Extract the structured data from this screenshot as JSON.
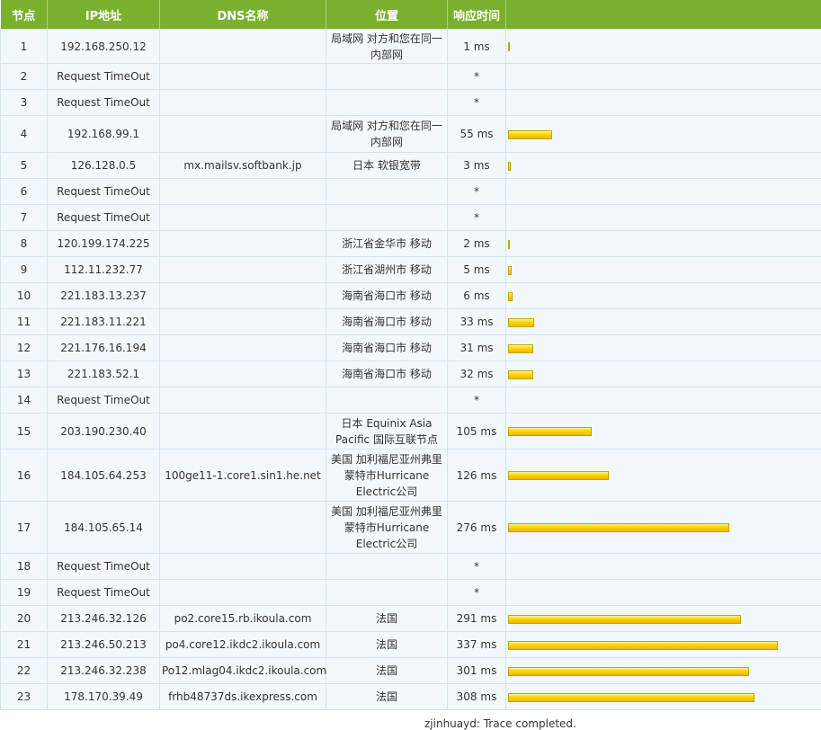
{
  "headers": {
    "hop": "节点",
    "ip": "IP地址",
    "dns": "DNS名称",
    "location": "位置",
    "time": "响应时间",
    "bar": ""
  },
  "rows": [
    {
      "hop": "1",
      "ip": "192.168.250.12",
      "dns": "",
      "location": "局域网 对方和您在同一内部网",
      "time": "1 ms",
      "ms": 1,
      "h": 38
    },
    {
      "hop": "2",
      "ip": "Request TimeOut",
      "dns": "",
      "location": "",
      "time": "*",
      "ms": 0,
      "h": 29
    },
    {
      "hop": "3",
      "ip": "Request TimeOut",
      "dns": "",
      "location": "",
      "time": "*",
      "ms": 0,
      "h": 29
    },
    {
      "hop": "4",
      "ip": "192.168.99.1",
      "dns": "",
      "location": "局域网 对方和您在同一内部网",
      "time": "55 ms",
      "ms": 55,
      "h": 41
    },
    {
      "hop": "5",
      "ip": "126.128.0.5",
      "dns": "mx.mailsv.softbank.jp",
      "location": "日本 软银宽带",
      "time": "3 ms",
      "ms": 3,
      "h": 29
    },
    {
      "hop": "6",
      "ip": "Request TimeOut",
      "dns": "",
      "location": "",
      "time": "*",
      "ms": 0,
      "h": 29
    },
    {
      "hop": "7",
      "ip": "Request TimeOut",
      "dns": "",
      "location": "",
      "time": "*",
      "ms": 0,
      "h": 29
    },
    {
      "hop": "8",
      "ip": "120.199.174.225",
      "dns": "",
      "location": "浙江省金华市 移动",
      "time": "2 ms",
      "ms": 2,
      "h": 29
    },
    {
      "hop": "9",
      "ip": "112.11.232.77",
      "dns": "",
      "location": "浙江省湖州市 移动",
      "time": "5 ms",
      "ms": 5,
      "h": 29
    },
    {
      "hop": "10",
      "ip": "221.183.13.237",
      "dns": "",
      "location": "海南省海口市 移动",
      "time": "6 ms",
      "ms": 6,
      "h": 29
    },
    {
      "hop": "11",
      "ip": "221.183.11.221",
      "dns": "",
      "location": "海南省海口市 移动",
      "time": "33 ms",
      "ms": 33,
      "h": 29
    },
    {
      "hop": "12",
      "ip": "221.176.16.194",
      "dns": "",
      "location": "海南省海口市 移动",
      "time": "31 ms",
      "ms": 31,
      "h": 29
    },
    {
      "hop": "13",
      "ip": "221.183.52.1",
      "dns": "",
      "location": "海南省海口市 移动",
      "time": "32 ms",
      "ms": 32,
      "h": 29
    },
    {
      "hop": "14",
      "ip": "Request TimeOut",
      "dns": "",
      "location": "",
      "time": "*",
      "ms": 0,
      "h": 29
    },
    {
      "hop": "15",
      "ip": "203.190.230.40",
      "dns": "",
      "location": "日本 Equinix Asia Pacific 国际互联节点",
      "time": "105 ms",
      "ms": 105,
      "h": 40
    },
    {
      "hop": "16",
      "ip": "184.105.64.253",
      "dns": "100ge11-1.core1.sin1.he.net",
      "location": "美国 加利福尼亚州弗里蒙特市Hurricane Electric公司",
      "time": "126 ms",
      "ms": 126,
      "h": 58
    },
    {
      "hop": "17",
      "ip": "184.105.65.14",
      "dns": "",
      "location": "美国 加利福尼亚州弗里蒙特市Hurricane Electric公司",
      "time": "276 ms",
      "ms": 276,
      "h": 58
    },
    {
      "hop": "18",
      "ip": "Request TimeOut",
      "dns": "",
      "location": "",
      "time": "*",
      "ms": 0,
      "h": 29
    },
    {
      "hop": "19",
      "ip": "Request TimeOut",
      "dns": "",
      "location": "",
      "time": "*",
      "ms": 0,
      "h": 29
    },
    {
      "hop": "20",
      "ip": "213.246.32.126",
      "dns": "po2.core15.rb.ikoula.com",
      "location": "法国",
      "time": "291 ms",
      "ms": 291,
      "h": 29
    },
    {
      "hop": "21",
      "ip": "213.246.50.213",
      "dns": "po4.core12.ikdc2.ikoula.com",
      "location": "法国",
      "time": "337 ms",
      "ms": 337,
      "h": 29
    },
    {
      "hop": "22",
      "ip": "213.246.32.238",
      "dns": "Po12.mlag04.ikdc2.ikoula.com",
      "location": "法国",
      "time": "301 ms",
      "ms": 301,
      "h": 29
    },
    {
      "hop": "23",
      "ip": "178.170.39.49",
      "dns": "frhb48737ds.ikexpress.com",
      "location": "法国",
      "time": "308 ms",
      "ms": 308,
      "h": 29
    }
  ],
  "footer": "zjinhuayd: Trace completed.",
  "colors": {
    "header_bg": "#79b12f",
    "row_bg": "#f3f8fd",
    "border": "#d5e3f0",
    "bar_fill": "#ffd700"
  }
}
